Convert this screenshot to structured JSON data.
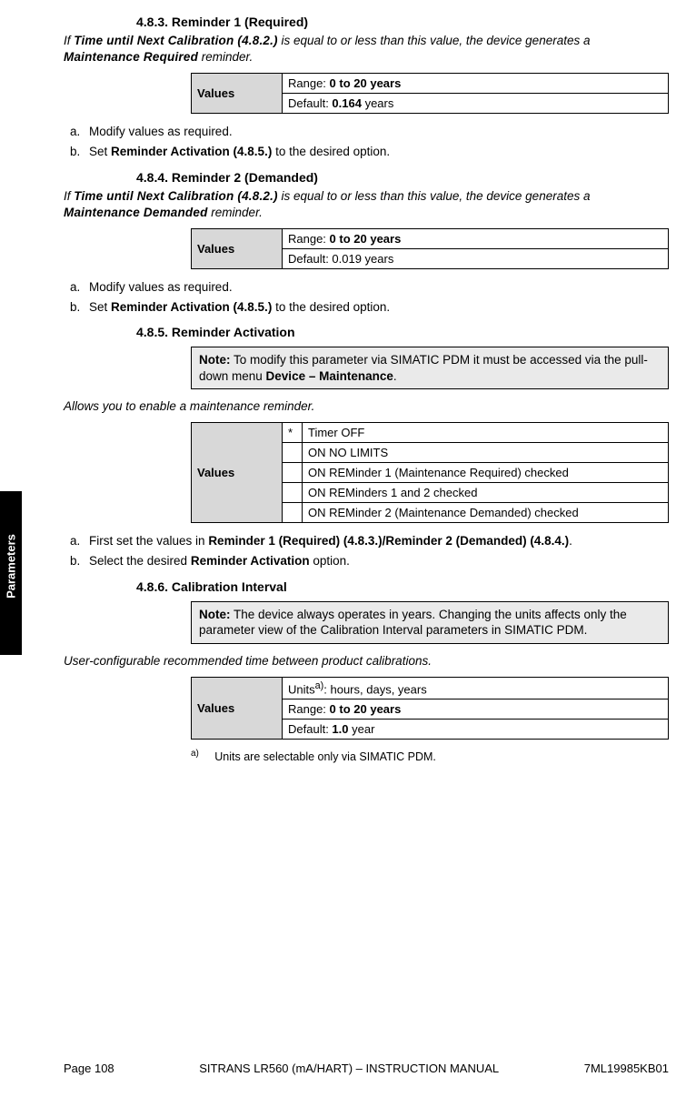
{
  "sideTab": "Parameters",
  "sections": {
    "s483": {
      "num": "4.8.3.",
      "title": "Reminder 1 (Required)",
      "desc_pre": "If ",
      "desc_bold1": "Time until Next Calibration (4.8.2.)",
      "desc_mid": " is equal to or less than this value, the device generates a ",
      "desc_bold2": "Maintenance Required",
      "desc_post": " reminder.",
      "values_label": "Values",
      "row1_pre": "Range: ",
      "row1_bold": "0 to 20 years",
      "row2_pre": "Default: ",
      "row2_bold": "0.164",
      "row2_post": " years",
      "step_a": "Modify values as required.",
      "step_b_pre": "Set ",
      "step_b_bold": "Reminder Activation (4.8.5.)",
      "step_b_post": " to the desired option."
    },
    "s484": {
      "num": "4.8.4.",
      "title": "Reminder 2 (Demanded)",
      "desc_pre": "If ",
      "desc_bold1": "Time until Next Calibration (4.8.2.)",
      "desc_mid": " is equal to or less than this value, the device generates a ",
      "desc_bold2": "Maintenance Demanded",
      "desc_post": " reminder.",
      "values_label": "Values",
      "row1_pre": "Range: ",
      "row1_bold": "0 to 20 years",
      "row2": "Default: 0.019 years",
      "step_a": "Modify values as required.",
      "step_b_pre": "Set ",
      "step_b_bold": "Reminder Activation (4.8.5.)",
      "step_b_post": " to the desired option."
    },
    "s485": {
      "num": "4.8.5.",
      "title": "Reminder Activation",
      "note_bold": "Note:",
      "note_text_pre": " To modify this parameter via SIMATIC PDM it must be accessed via the pull-down menu ",
      "note_text_bold": "Device – Maintenance",
      "note_text_post": ".",
      "desc": "Allows you to enable a maintenance reminder.",
      "values_label": "Values",
      "star": "*",
      "opt1": "Timer OFF",
      "opt2": "ON NO LIMITS",
      "opt3": "ON REMinder 1 (Maintenance Required) checked",
      "opt4": "ON REMinders 1 and 2 checked",
      "opt5": "ON REMinder 2 (Maintenance Demanded) checked",
      "step_a_pre": "First set the values in ",
      "step_a_bold": "Reminder 1 (Required) (4.8.3.)/Reminder 2 (Demanded) (4.8.4.)",
      "step_a_post": ".",
      "step_b_pre": "Select the desired ",
      "step_b_bold": "Reminder Activation",
      "step_b_post": " option."
    },
    "s486": {
      "num": "4.8.6.",
      "title": "Calibration Interval",
      "note_bold": "Note:",
      "note_text": " The device always operates in years. Changing the units affects only the parameter view of the Calibration Interval parameters in SIMATIC PDM.",
      "desc": "User-configurable recommended time between product calibrations.",
      "values_label": "Values",
      "row1_pre": "Units",
      "row1_sup": "a)",
      "row1_post": ": hours, days, years",
      "row2_pre": "Range: ",
      "row2_bold": "0 to 20 years",
      "row3_pre": "Default: ",
      "row3_bold": "1.0",
      "row3_post": " year",
      "footnote_marker": "a)",
      "footnote_text": "Units are selectable only via SIMATIC PDM."
    }
  },
  "footer": {
    "left": "Page 108",
    "center": "SITRANS LR560 (mA/HART) – INSTRUCTION MANUAL",
    "right": "7ML19985KB01"
  }
}
